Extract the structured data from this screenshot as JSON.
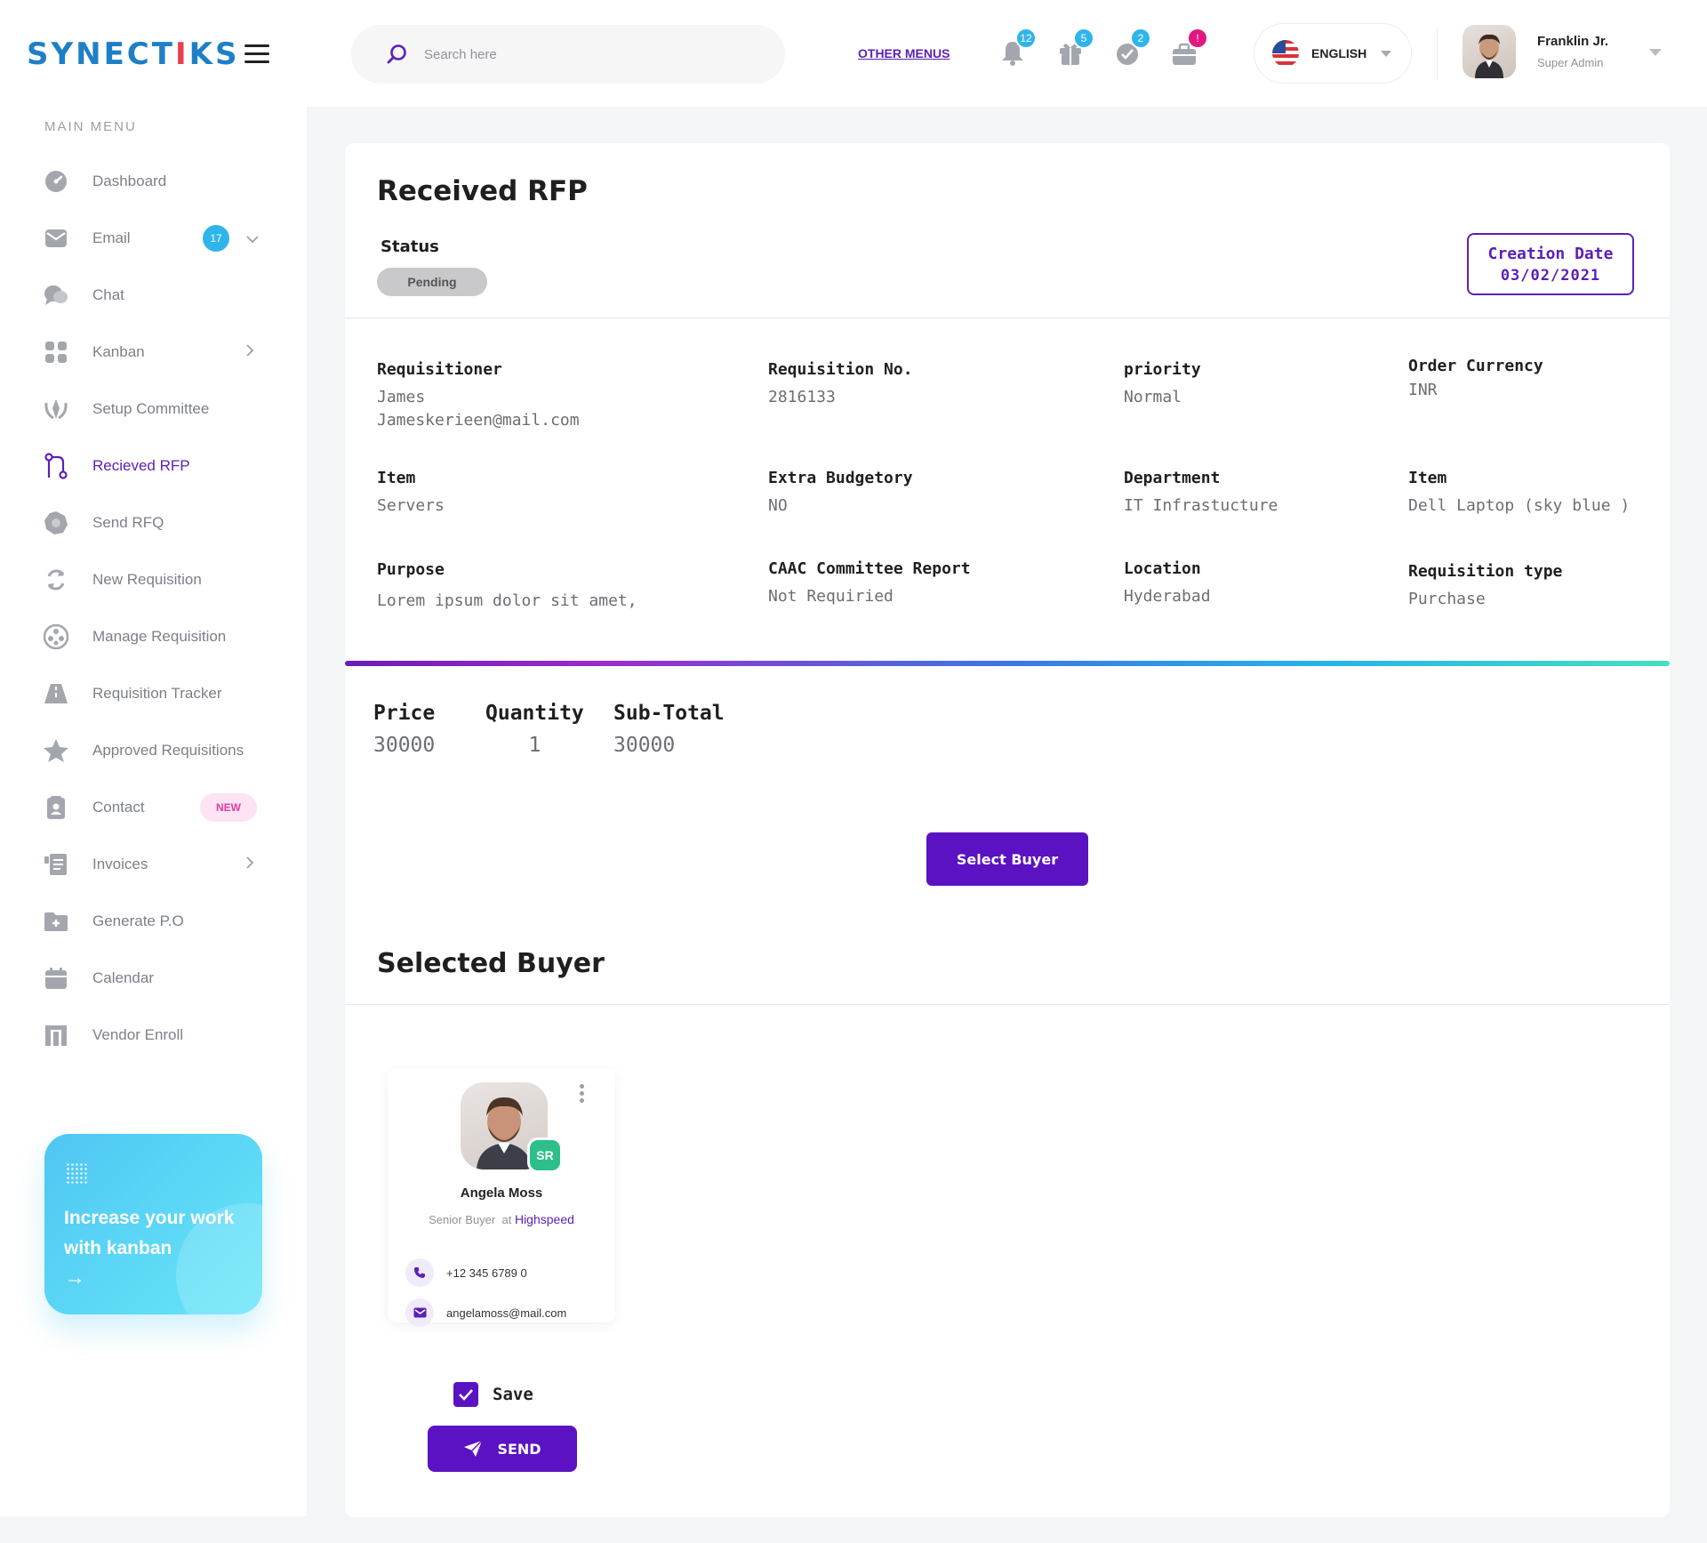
{
  "brand": {
    "logo_part1": "SYNECT",
    "logo_part2": "I",
    "logo_part3": "KS"
  },
  "sidebar": {
    "menu_title": "MAIN MENU",
    "items": [
      {
        "label": "Dashboard",
        "icon": "dashboard-icon"
      },
      {
        "label": "Email",
        "icon": "email-icon",
        "badge": "17"
      },
      {
        "label": "Chat",
        "icon": "chat-icon"
      },
      {
        "label": "Kanban",
        "icon": "kanban-icon"
      },
      {
        "label": "Setup Committee",
        "icon": "committee-icon"
      },
      {
        "label": "Recieved RFP",
        "icon": "git-branch-icon",
        "active": true
      },
      {
        "label": "Send RFQ",
        "icon": "send-rfq-icon"
      },
      {
        "label": "New Requisition",
        "icon": "refresh-icon"
      },
      {
        "label": "Manage Requisition",
        "icon": "manage-icon"
      },
      {
        "label": "Requisition Tracker",
        "icon": "road-icon"
      },
      {
        "label": "Approved Requisitions",
        "icon": "star-icon"
      },
      {
        "label": "Contact",
        "icon": "contact-icon",
        "tag": "NEW"
      },
      {
        "label": "Invoices",
        "icon": "invoice-icon"
      },
      {
        "label": "Generate P.O",
        "icon": "folder-plus-icon"
      },
      {
        "label": "Calendar",
        "icon": "calendar-icon"
      },
      {
        "label": "Vendor Enroll",
        "icon": "vendor-icon"
      }
    ],
    "promo": {
      "text": "Increase your work with kanban",
      "arrow": "→"
    }
  },
  "header": {
    "search_placeholder": "Search here",
    "other_menus": "OTHER MENUS",
    "badges": {
      "notifications": "12",
      "gifts": "5",
      "messages": "2",
      "alerts": "!"
    },
    "language": "ENGLISH",
    "user": {
      "name": "Franklin Jr.",
      "role": "Super Admin"
    }
  },
  "page": {
    "title": "Received RFP",
    "status_label": "Status",
    "status_value": "Pending",
    "creation_label": "Creation Date",
    "creation_date": "03/02/2021",
    "fields": {
      "requisitioner": {
        "label": "Requisitioner",
        "name": "James",
        "email": "Jameskerieen@mail.com"
      },
      "requisition_no": {
        "label": "Requisition No.",
        "value": "2816133"
      },
      "priority": {
        "label": "priority",
        "value": "Normal"
      },
      "order_currency": {
        "label": "Order Currency",
        "value": "INR"
      },
      "item1": {
        "label": "Item",
        "value": "Servers"
      },
      "extra_budget": {
        "label": "Extra Budgetory",
        "value": "NO"
      },
      "department": {
        "label": "Department",
        "value": "IT Infrastucture"
      },
      "item2": {
        "label": "Item",
        "value": "Dell Laptop (sky blue )"
      },
      "purpose": {
        "label": "Purpose",
        "value": "Lorem ipsum dolor sit amet,"
      },
      "caac": {
        "label": "CAAC Committee Report",
        "value": "Not Requiried"
      },
      "location": {
        "label": "Location",
        "value": "Hyderabad"
      },
      "req_type": {
        "label": "Requisition type",
        "value": "Purchase"
      }
    },
    "totals": {
      "price_label": "Price",
      "price": "30000",
      "qty_label": "Quantity",
      "qty": "1",
      "subtotal_label": "Sub-Total",
      "subtotal": "30000"
    },
    "select_buyer": "Select Buyer",
    "selected_buyer_title": "Selected Buyer",
    "buyer": {
      "name": "Angela Moss",
      "badge": "SR",
      "role": "Senior Buyer",
      "at": "at",
      "company": "Highspeed",
      "phone": "+12 345 6789 0",
      "email": "angelamoss@mail.com"
    },
    "save_label": "Save",
    "send_label": "SEND"
  },
  "colors": {
    "accent": "#5b12c2",
    "brand_blue": "#1e7fc6",
    "badge_blue": "#2fb5ec",
    "badge_pink": "#e2187f",
    "success": "#2dbf8a"
  }
}
